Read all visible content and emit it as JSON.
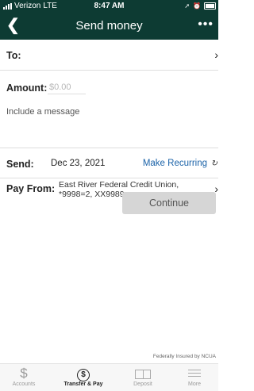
{
  "status": {
    "carrier": "Verizon",
    "network": "LTE",
    "time": "8:47 AM"
  },
  "nav": {
    "back_icon": "chevron-left-icon",
    "title": "Send money",
    "more_label": "•••"
  },
  "form": {
    "to_label": "To:",
    "amount_label": "Amount:",
    "amount_placeholder": "$0.00",
    "message_placeholder": "Include a message",
    "send_label": "Send:",
    "send_date": "Dec 23, 2021",
    "make_recurring": "Make Recurring",
    "pay_from_label": "Pay From:",
    "pay_from_line1": "East River Federal Credit Union,",
    "pay_from_line2": "*9998=2, XX9989",
    "continue_label": "Continue"
  },
  "footer": {
    "ncua": "Federally Insured by NCUA"
  },
  "tabs": [
    {
      "label": "Accounts",
      "icon": "dollar-icon"
    },
    {
      "label": "Transfer & Pay",
      "icon": "transfer-pay-icon",
      "active": true
    },
    {
      "label": "Deposit",
      "icon": "deposit-check-icon"
    },
    {
      "label": "More",
      "icon": "menu-icon"
    }
  ],
  "colors": {
    "header_bg": "#0d3b33",
    "link": "#1a62a8",
    "button_bg": "#d6d6d6"
  }
}
